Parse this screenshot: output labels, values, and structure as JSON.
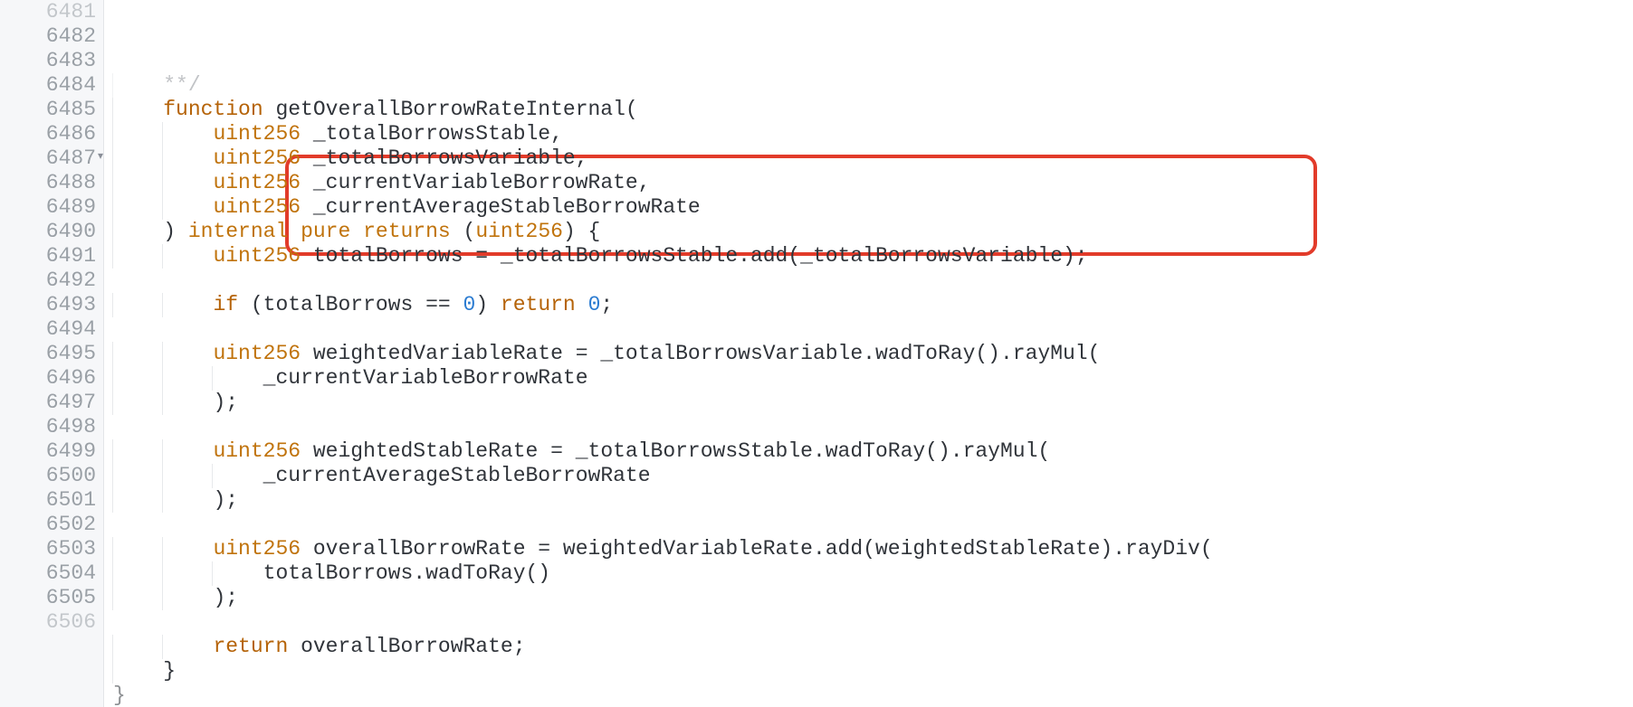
{
  "line_start": 6481,
  "fold_line": 6487,
  "lines": {
    "l6481": {
      "indent": 1,
      "tokens": [
        {
          "t": "**/",
          "cls": "comment"
        }
      ]
    },
    "l6482": {
      "indent": 1,
      "tokens": [
        {
          "t": "function",
          "cls": "kw-fn"
        },
        {
          "t": " getOverallBorrowRateInternal(",
          "cls": "ident"
        }
      ]
    },
    "l6483": {
      "indent": 2,
      "tokens": [
        {
          "t": "uint256",
          "cls": "kw-type"
        },
        {
          "t": " _totalBorrowsStable,",
          "cls": "ident"
        }
      ]
    },
    "l6484": {
      "indent": 2,
      "tokens": [
        {
          "t": "uint256",
          "cls": "kw-type"
        },
        {
          "t": " _totalBorrowsVariable,",
          "cls": "ident"
        }
      ]
    },
    "l6485": {
      "indent": 2,
      "tokens": [
        {
          "t": "uint256",
          "cls": "kw-type"
        },
        {
          "t": " _currentVariableBorrowRate,",
          "cls": "ident"
        }
      ]
    },
    "l6486": {
      "indent": 2,
      "tokens": [
        {
          "t": "uint256",
          "cls": "kw-type"
        },
        {
          "t": " _currentAverageStableBorrowRate",
          "cls": "ident"
        }
      ]
    },
    "l6487": {
      "indent": 1,
      "tokens": [
        {
          "t": ") ",
          "cls": "punct"
        },
        {
          "t": "internal",
          "cls": "kw-type"
        },
        {
          "t": " ",
          "cls": "punct"
        },
        {
          "t": "pure",
          "cls": "kw-type"
        },
        {
          "t": " ",
          "cls": "punct"
        },
        {
          "t": "returns",
          "cls": "kw-type"
        },
        {
          "t": " (",
          "cls": "punct"
        },
        {
          "t": "uint256",
          "cls": "kw-type"
        },
        {
          "t": ") {",
          "cls": "punct"
        }
      ]
    },
    "l6488": {
      "indent": 2,
      "tokens": [
        {
          "t": "uint256",
          "cls": "kw-type"
        },
        {
          "t": " totalBorrows = _totalBorrowsStable.add(_totalBorrowsVariable);",
          "cls": "ident"
        }
      ]
    },
    "l6489": {
      "indent": 0,
      "tokens": []
    },
    "l6490": {
      "indent": 2,
      "tokens": [
        {
          "t": "if",
          "cls": "kw-ctrl"
        },
        {
          "t": " (totalBorrows == ",
          "cls": "ident"
        },
        {
          "t": "0",
          "cls": "num"
        },
        {
          "t": ") ",
          "cls": "punct"
        },
        {
          "t": "return",
          "cls": "kw-ctrl"
        },
        {
          "t": " ",
          "cls": "punct"
        },
        {
          "t": "0",
          "cls": "num"
        },
        {
          "t": ";",
          "cls": "punct"
        }
      ]
    },
    "l6491": {
      "indent": 0,
      "tokens": []
    },
    "l6492": {
      "indent": 2,
      "tokens": [
        {
          "t": "uint256",
          "cls": "kw-type"
        },
        {
          "t": " weightedVariableRate = _totalBorrowsVariable.wadToRay().rayMul(",
          "cls": "ident"
        }
      ]
    },
    "l6493": {
      "indent": 3,
      "tokens": [
        {
          "t": "_currentVariableBorrowRate",
          "cls": "ident"
        }
      ]
    },
    "l6494": {
      "indent": 2,
      "tokens": [
        {
          "t": ");",
          "cls": "punct"
        }
      ]
    },
    "l6495": {
      "indent": 0,
      "tokens": []
    },
    "l6496": {
      "indent": 2,
      "tokens": [
        {
          "t": "uint256",
          "cls": "kw-type"
        },
        {
          "t": " weightedStableRate = _totalBorrowsStable.wadToRay().rayMul(",
          "cls": "ident"
        }
      ]
    },
    "l6497": {
      "indent": 3,
      "tokens": [
        {
          "t": "_currentAverageStableBorrowRate",
          "cls": "ident"
        }
      ]
    },
    "l6498": {
      "indent": 2,
      "tokens": [
        {
          "t": ");",
          "cls": "punct"
        }
      ]
    },
    "l6499": {
      "indent": 0,
      "tokens": []
    },
    "l6500": {
      "indent": 2,
      "tokens": [
        {
          "t": "uint256",
          "cls": "kw-type"
        },
        {
          "t": " overallBorrowRate = weightedVariableRate.add(weightedStableRate).rayDiv(",
          "cls": "ident"
        }
      ]
    },
    "l6501": {
      "indent": 3,
      "tokens": [
        {
          "t": "totalBorrows.wadToRay()",
          "cls": "ident"
        }
      ]
    },
    "l6502": {
      "indent": 2,
      "tokens": [
        {
          "t": ");",
          "cls": "punct"
        }
      ]
    },
    "l6503": {
      "indent": 0,
      "tokens": []
    },
    "l6504": {
      "indent": 2,
      "tokens": [
        {
          "t": "return",
          "cls": "kw-ctrl"
        },
        {
          "t": " overallBorrowRate;",
          "cls": "ident"
        }
      ]
    },
    "l6505": {
      "indent": 1,
      "tokens": [
        {
          "t": "}",
          "cls": "punct"
        }
      ]
    },
    "l6506": {
      "indent": 0,
      "tokens": [
        {
          "t": "}",
          "cls": "punct"
        }
      ]
    }
  },
  "indent_unit": "    ",
  "highlight": {
    "from_line": 6488,
    "to_line": 6491
  }
}
